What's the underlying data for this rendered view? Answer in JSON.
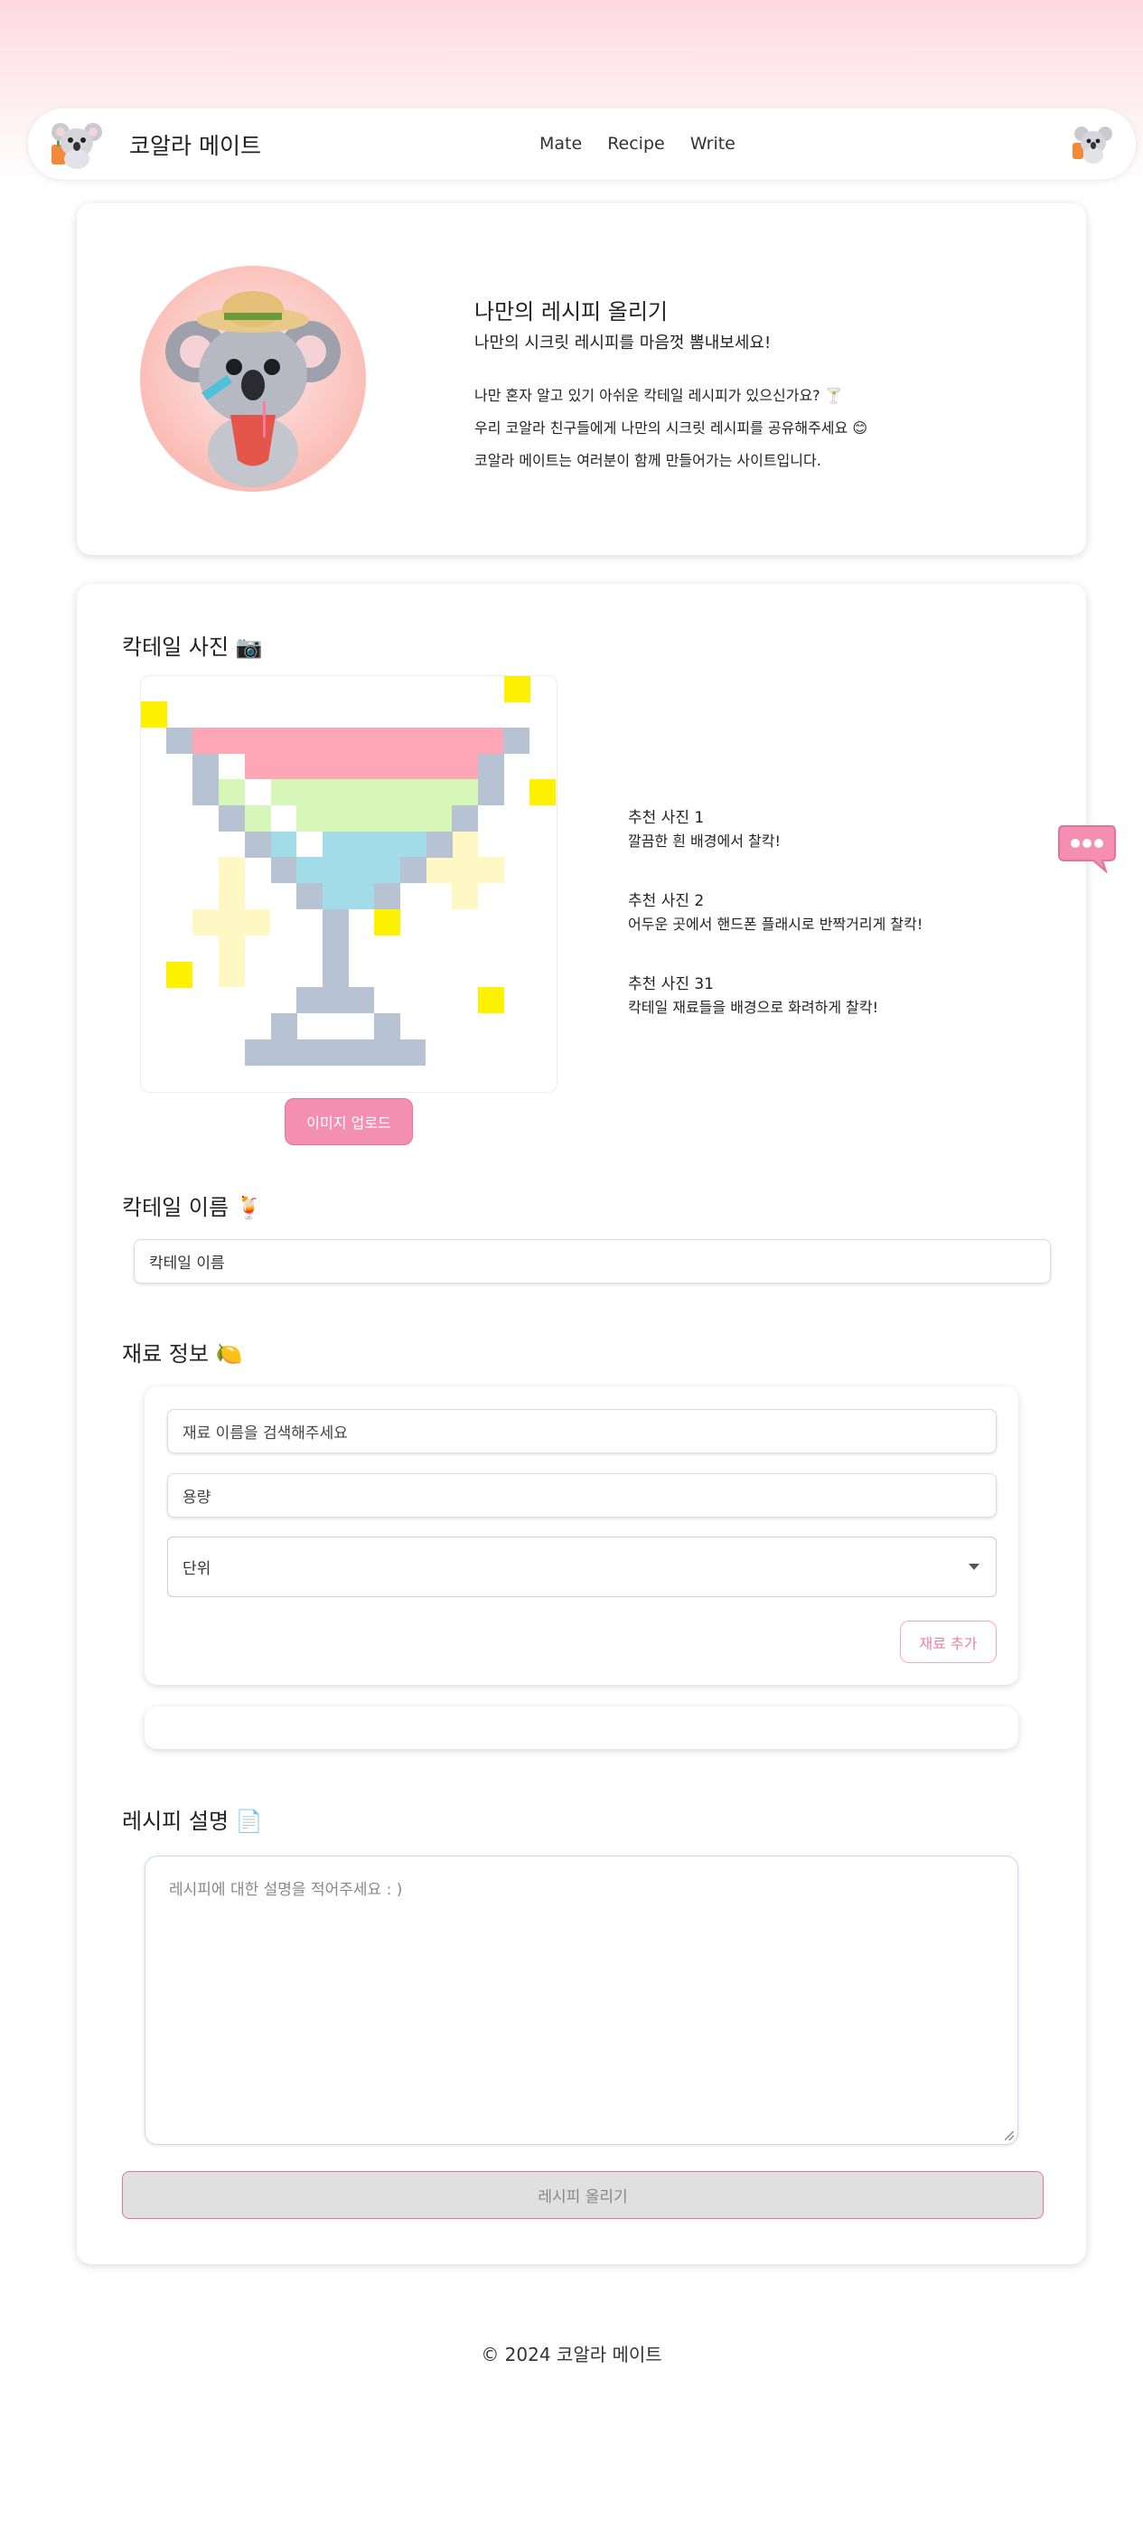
{
  "header": {
    "brand": "코알라 메이트",
    "menu": [
      "Mate",
      "Recipe",
      "Write"
    ]
  },
  "intro": {
    "title": "나만의 레시피 올리기",
    "subtitle": "나만의 시크릿 레시피를 마음껏 뽐내보세요!",
    "lines": [
      "나만 혼자 알고 있기 아쉬운 칵테일 레시피가 있으신가요? 🍸",
      "우리 코알라 친구들에게 나만의 시크릿 레시피를 공유해주세요 😊",
      "코알라 메이트는 여러분이 함께 만들어가는 사이트입니다."
    ]
  },
  "form": {
    "photo_title": "칵테일 사진 📷",
    "upload_label": "이미지 업로드",
    "tips": [
      {
        "title": "추천 사진 1",
        "text": "깔끔한 흰 배경에서 찰칵!"
      },
      {
        "title": "추천 사진 2",
        "text": "어두운 곳에서 핸드폰 플래시로 반짝거리게 찰칵!"
      },
      {
        "title": "추천 사진 31",
        "text": "칵테일 재료들을 배경으로 화려하게 찰칵!"
      }
    ],
    "name_title": "칵테일 이름 🍹",
    "name_placeholder": "칵테일 이름",
    "ingredient_title": "재료 정보 🍋",
    "ingredient_search_placeholder": "재료 이름을 검색해주세요",
    "amount_placeholder": "용량",
    "unit_label": "단위",
    "add_label": "재료 추가",
    "desc_title": "레시피 설명 📄",
    "desc_placeholder": "레시피에 대한 설명을 적어주세요 : )",
    "submit_label": "레시피 올리기"
  },
  "footer": {
    "copyright": "© 2024 코알라 메이트"
  },
  "colors": {
    "accent_pink": "#f48fb1",
    "header_gradient": "#fdd9e0"
  }
}
